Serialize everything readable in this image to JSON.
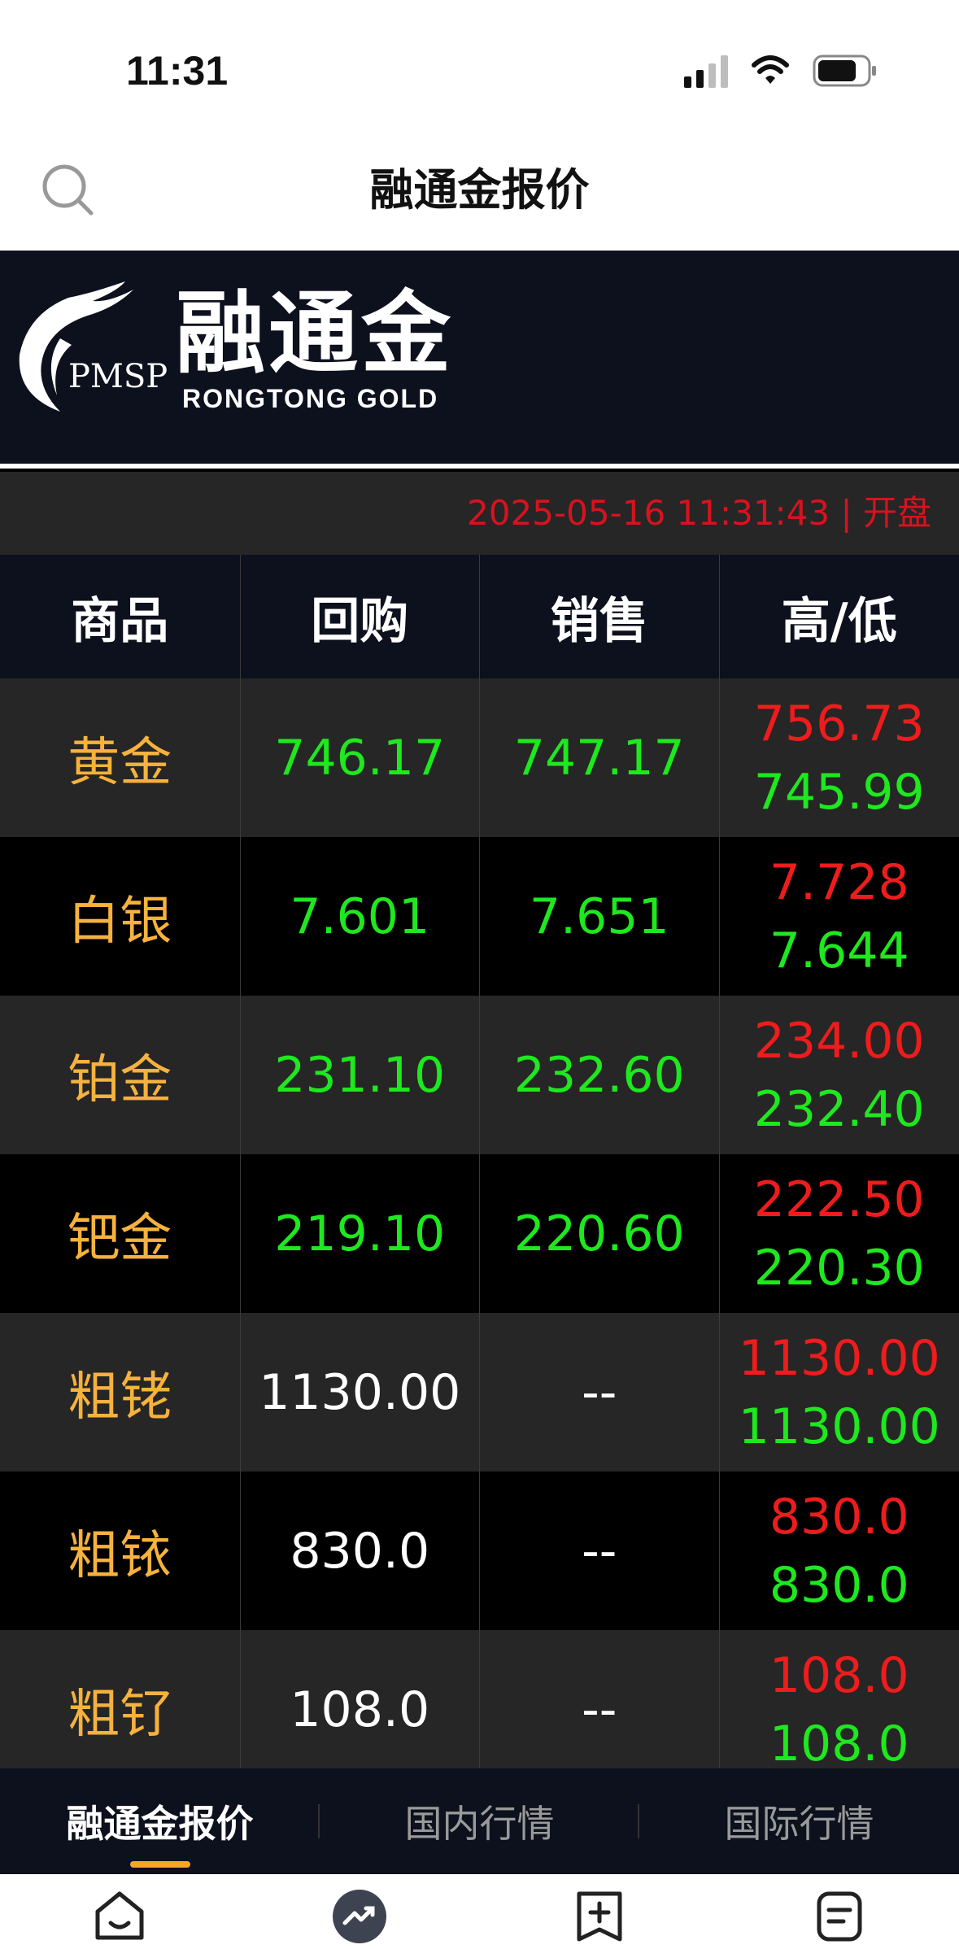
{
  "status_bar": {
    "time": "11:31"
  },
  "header": {
    "title": "融通金报价"
  },
  "banner": {
    "logo_cn": "融通金",
    "logo_en": "RONGTONG  GOLD",
    "logo_pmsp": "PMSP"
  },
  "quote_time": "2025-05-16 11:31:43 | 开盘",
  "table": {
    "columns": [
      "商品",
      "回购",
      "销售",
      "高/低"
    ],
    "rows": [
      {
        "name": "黄金",
        "buy": "746.17",
        "sell": "747.17",
        "high": "756.73",
        "low": "745.99"
      },
      {
        "name": "白银",
        "buy": "7.601",
        "sell": "7.651",
        "high": "7.728",
        "low": "7.644"
      },
      {
        "name": "铂金",
        "buy": "231.10",
        "sell": "232.60",
        "high": "234.00",
        "low": "232.40"
      },
      {
        "name": "钯金",
        "buy": "219.10",
        "sell": "220.60",
        "high": "222.50",
        "low": "220.30"
      },
      {
        "name": "粗铑",
        "buy": "1130.00",
        "sell": "--",
        "high": "1130.00",
        "low": "1130.00"
      },
      {
        "name": "粗铱",
        "buy": "830.0",
        "sell": "--",
        "high": "830.0",
        "low": "830.0"
      },
      {
        "name": "粗钌",
        "buy": "108.0",
        "sell": "--",
        "high": "108.0",
        "low": "108.0"
      }
    ]
  },
  "tabs": [
    "融通金报价",
    "国内行情",
    "国际行情"
  ],
  "bottom_nav": [
    {
      "icon": "home-icon"
    },
    {
      "icon": "trend-icon"
    },
    {
      "icon": "bookmark-add-icon"
    },
    {
      "icon": "document-icon"
    }
  ],
  "colors": {
    "accent": "#f5a623",
    "name": "#f6b23c",
    "up": "#ee1c1c",
    "down": "#1ee81e",
    "banner_bg": "#0c111d"
  }
}
